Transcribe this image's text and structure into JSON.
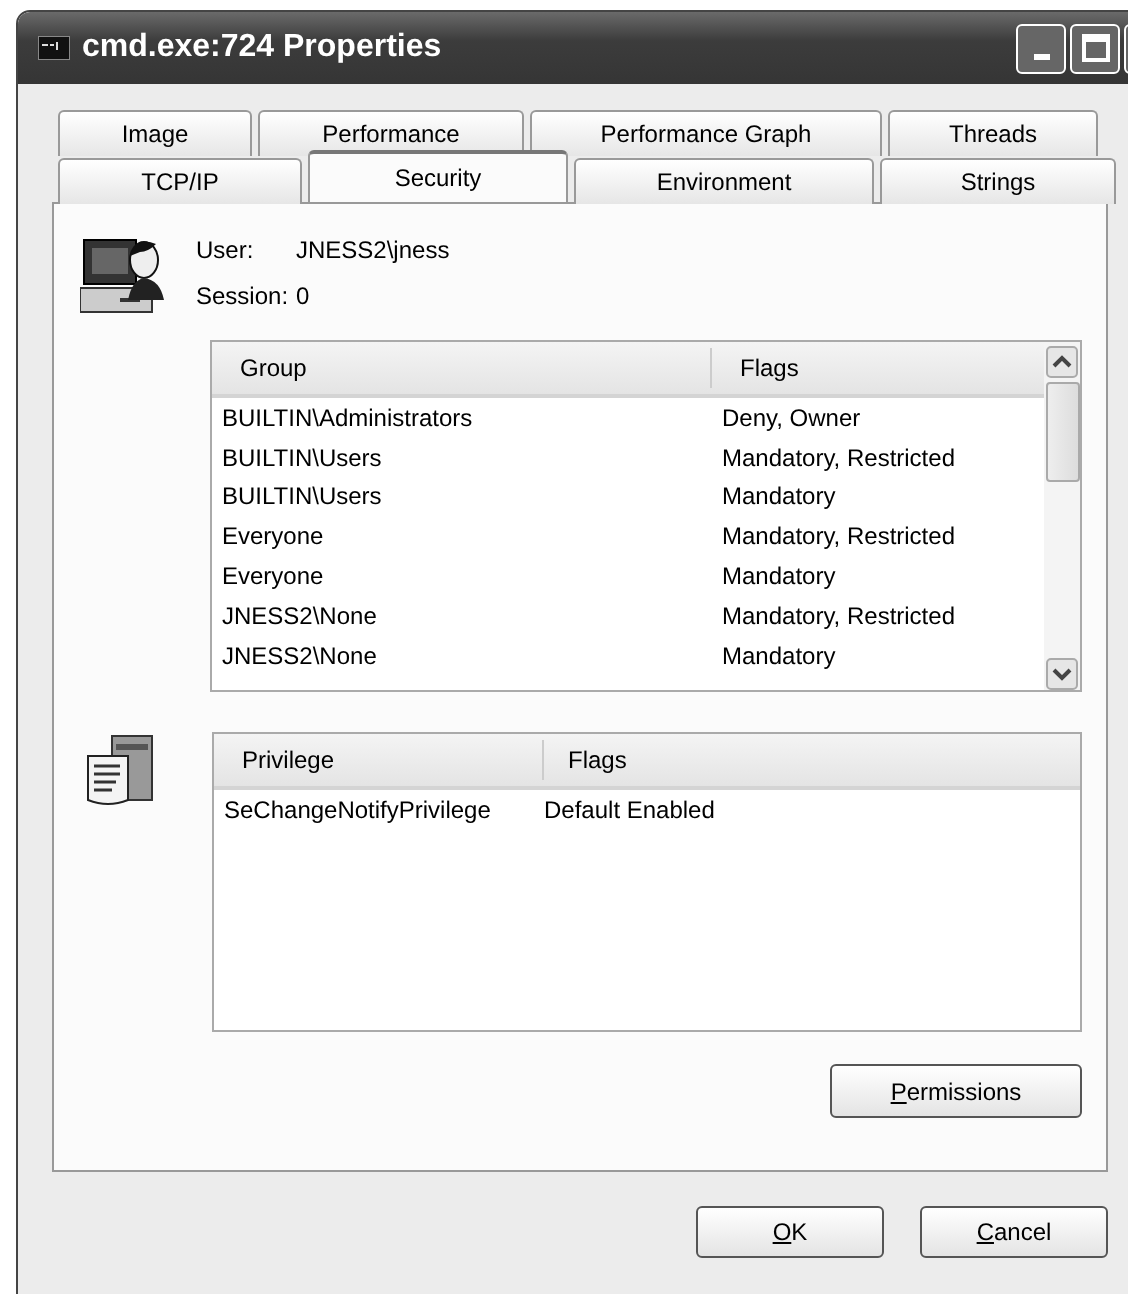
{
  "window": {
    "title": "cmd.exe:724 Properties"
  },
  "tab_rows": [
    {
      "tabs": [
        {
          "label": "Image",
          "selected": false
        },
        {
          "label": "Performance",
          "selected": false
        },
        {
          "label": "Performance Graph",
          "selected": false
        },
        {
          "label": "Threads",
          "selected": false
        }
      ]
    },
    {
      "tabs": [
        {
          "label": "TCP/IP",
          "selected": false
        },
        {
          "label": "Security",
          "selected": true
        },
        {
          "label": "Environment",
          "selected": false
        },
        {
          "label": "Strings",
          "selected": false
        }
      ]
    }
  ],
  "user": {
    "label": "User:",
    "value": "JNESS2\\jness"
  },
  "session": {
    "label": "Session:",
    "value": "0"
  },
  "groups": {
    "columns": [
      "Group",
      "Flags"
    ],
    "rows": [
      {
        "group": "BUILTIN\\Administrators",
        "flags": "Deny, Owner"
      },
      {
        "group": "BUILTIN\\Users",
        "flags": "Mandatory, Restricted"
      },
      {
        "group": "BUILTIN\\Users",
        "flags": "Mandatory"
      },
      {
        "group": "Everyone",
        "flags": "Mandatory, Restricted"
      },
      {
        "group": "Everyone",
        "flags": "Mandatory"
      },
      {
        "group": "JNESS2\\None",
        "flags": "Mandatory, Restricted"
      },
      {
        "group": "JNESS2\\None",
        "flags": "Mandatory"
      }
    ]
  },
  "privileges": {
    "columns": [
      "Privilege",
      "Flags"
    ],
    "rows": [
      {
        "privilege": "SeChangeNotifyPrivilege",
        "flags": "Default Enabled"
      }
    ]
  },
  "permissions_button": {
    "label": "Permissions",
    "mnemonic": true
  },
  "buttons": [
    {
      "label": "OK",
      "mnemonic": true
    },
    {
      "label": "Cancel",
      "mnemonic": true
    }
  ]
}
